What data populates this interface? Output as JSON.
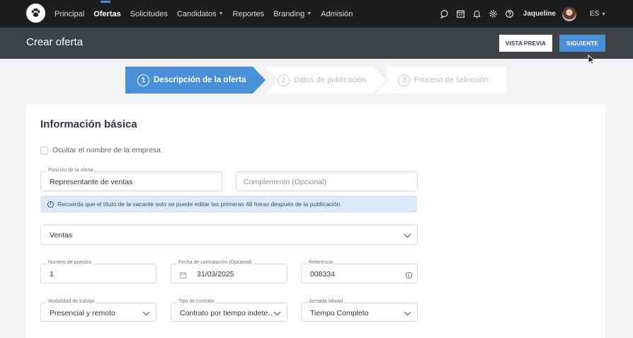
{
  "nav": {
    "items": [
      {
        "label": "Principal",
        "active": false,
        "dropdown": false
      },
      {
        "label": "Ofertas",
        "active": true,
        "dropdown": false
      },
      {
        "label": "Solicitudes",
        "active": false,
        "dropdown": false
      },
      {
        "label": "Candidatos",
        "active": false,
        "dropdown": true
      },
      {
        "label": "Reportes",
        "active": false,
        "dropdown": false
      },
      {
        "label": "Branding",
        "active": false,
        "dropdown": true
      },
      {
        "label": "Admisión",
        "active": false,
        "dropdown": false
      }
    ],
    "icons": [
      "chat-icon",
      "calendar-icon",
      "bell-icon",
      "gear-icon",
      "help-icon"
    ],
    "username": "Jaqueline",
    "language": "ES"
  },
  "header": {
    "title": "Crear oferta",
    "preview_label": "VISTA PREVIA",
    "next_label": "SIGUIENTE"
  },
  "stepper": {
    "steps": [
      {
        "num": "1",
        "label": "Descripción de la oferta",
        "active": true
      },
      {
        "num": "2",
        "label": "Datos de publicación",
        "active": false
      },
      {
        "num": "3",
        "label": "Proceso de selección",
        "active": false
      }
    ]
  },
  "form": {
    "section_title": "Información básica",
    "hide_company_label": "Ocultar el nombre de la empresa",
    "position_label": "Posición de la oferta",
    "position_value": "Representante de ventas",
    "complement_placeholder": "Complemento (Opcional)",
    "info_text": "Recuerda que el título de la vacante solo se puede editar las primeras 48 horas después de la publicación.",
    "category_value": "Ventas",
    "positions_label": "Número de puestos",
    "positions_value": "1",
    "hire_date_label": "Fecha de contratación (Opcional)",
    "hire_date_value": "31/03/2025",
    "reference_label": "Referencia",
    "reference_value": "008334",
    "work_mode_label": "Modalidad de trabajo",
    "work_mode_value": "Presencial y remoto",
    "contract_label": "Tipo de contrato",
    "contract_value": "Contrato por tiempo indete…",
    "schedule_label": "Jornada laboral",
    "schedule_value": "Tiempo Completo"
  },
  "colors": {
    "nav_bg": "#1c1d1f",
    "subheader_bg": "#3f4246",
    "accent": "#4a90d9",
    "info_bg": "#dbe9f7"
  }
}
